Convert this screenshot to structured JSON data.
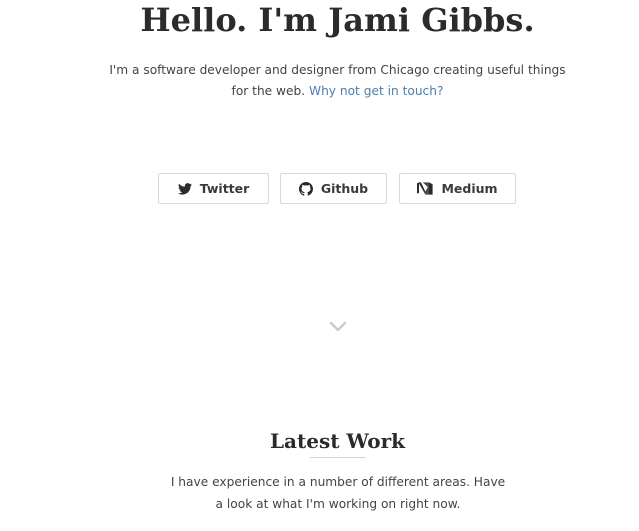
{
  "hero": {
    "title": "Hello. I'm Jami Gibbs.",
    "intro_text": "I'm a software developer and designer from Chicago creating useful things for the web.",
    "contact_link": "Why not get in touch?"
  },
  "social": {
    "twitter": {
      "label": "Twitter",
      "icon": "twitter-bird-icon"
    },
    "github": {
      "label": "Github",
      "icon": "github-octocat-icon"
    },
    "medium": {
      "label": "Medium",
      "icon": "medium-logo-icon"
    }
  },
  "scroll_indicator": {
    "icon": "chevron-down-icon",
    "color": "#c8ccd0"
  },
  "latest_work": {
    "title": "Latest Work",
    "description": "I have experience in a number of different areas. Have a look at what I'm working on right now."
  },
  "colors": {
    "link": "#4a7fad",
    "heading": "#2b2b2b",
    "text": "#444444",
    "button_border": "#d9d9d9"
  }
}
